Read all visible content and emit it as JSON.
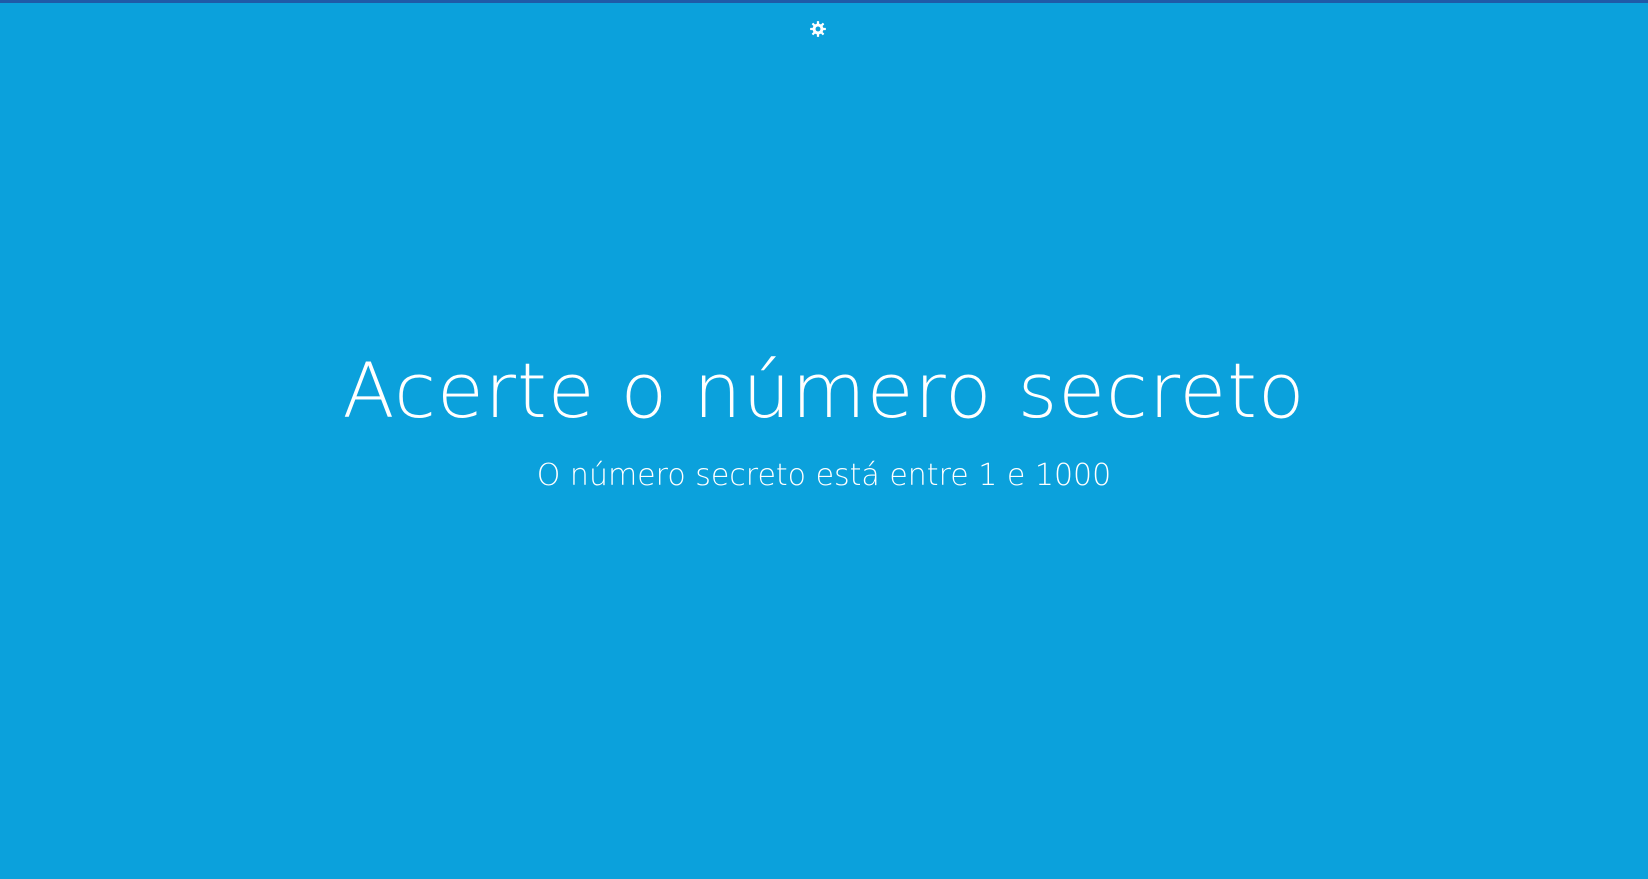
{
  "page": {
    "background_color": "#0ba1dc",
    "accent_strip_color": "#1f5aa8",
    "text_color": "#ffffff"
  },
  "toolbar": {
    "settings_icon": "gear-icon"
  },
  "main": {
    "title": "Acerte o número secreto",
    "subtitle": "O número secreto está entre 1 e 1000"
  }
}
